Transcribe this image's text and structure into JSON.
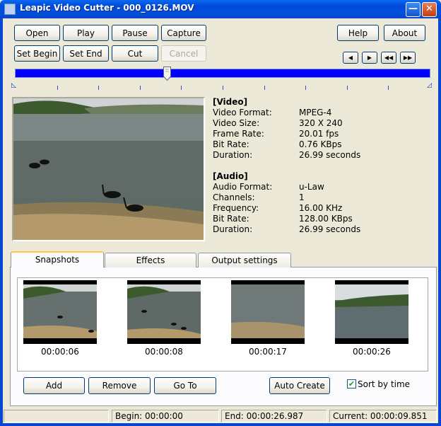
{
  "window": {
    "title": "Leapic Video Cutter - 000_0126.MOV",
    "minimize": "—",
    "close": "✕"
  },
  "toolbar": {
    "open": "Open",
    "play": "Play",
    "pause": "Pause",
    "capture": "Capture",
    "set_begin": "Set Begin",
    "set_end": "Set End",
    "cut": "Cut",
    "cancel": "Cancel",
    "help": "Help",
    "about": "About"
  },
  "nav_buttons": {
    "prev_frame": "◀",
    "next_frame": "▶",
    "rewind": "◀◀",
    "fast_forward": "▶▶"
  },
  "slider": {
    "position_fraction": 0.366
  },
  "video_info": {
    "heading": "[Video]",
    "rows": [
      {
        "label": "Video Format:",
        "value": "MPEG-4"
      },
      {
        "label": "Video Size:",
        "value": "320 X 240"
      },
      {
        "label": "Frame Rate:",
        "value": "20.01 fps"
      },
      {
        "label": "Bit Rate:",
        "value": "0.76 KBps"
      },
      {
        "label": "Duration:",
        "value": "26.99 seconds"
      }
    ]
  },
  "audio_info": {
    "heading": "[Audio]",
    "rows": [
      {
        "label": "Audio Format:",
        "value": "u-Law"
      },
      {
        "label": "Channels:",
        "value": "1"
      },
      {
        "label": "Frequency:",
        "value": "16.00 KHz"
      },
      {
        "label": "Bit Rate:",
        "value": "128.00 KBps"
      },
      {
        "label": "Duration:",
        "value": "26.99 seconds"
      }
    ]
  },
  "tabs": {
    "snapshots": "Snapshots",
    "effects": "Effects",
    "output_settings": "Output settings"
  },
  "snapshots": [
    {
      "time": "00:00:06"
    },
    {
      "time": "00:00:08"
    },
    {
      "time": "00:00:17"
    },
    {
      "time": "00:00:26"
    }
  ],
  "snapshot_actions": {
    "add": "Add",
    "remove": "Remove",
    "go_to": "Go To",
    "auto_create": "Auto Create",
    "sort_by_time": "Sort by time",
    "sort_checked": "✔"
  },
  "status_bar": {
    "begin": "Begin: 00:00:00",
    "end": "End: 00:00:26.987",
    "current": "Current: 00:00:09.851"
  },
  "colors": {
    "title_bar": "#0054e3",
    "slider_track": "#0000ff",
    "tab_highlight": "#ffc83c"
  }
}
